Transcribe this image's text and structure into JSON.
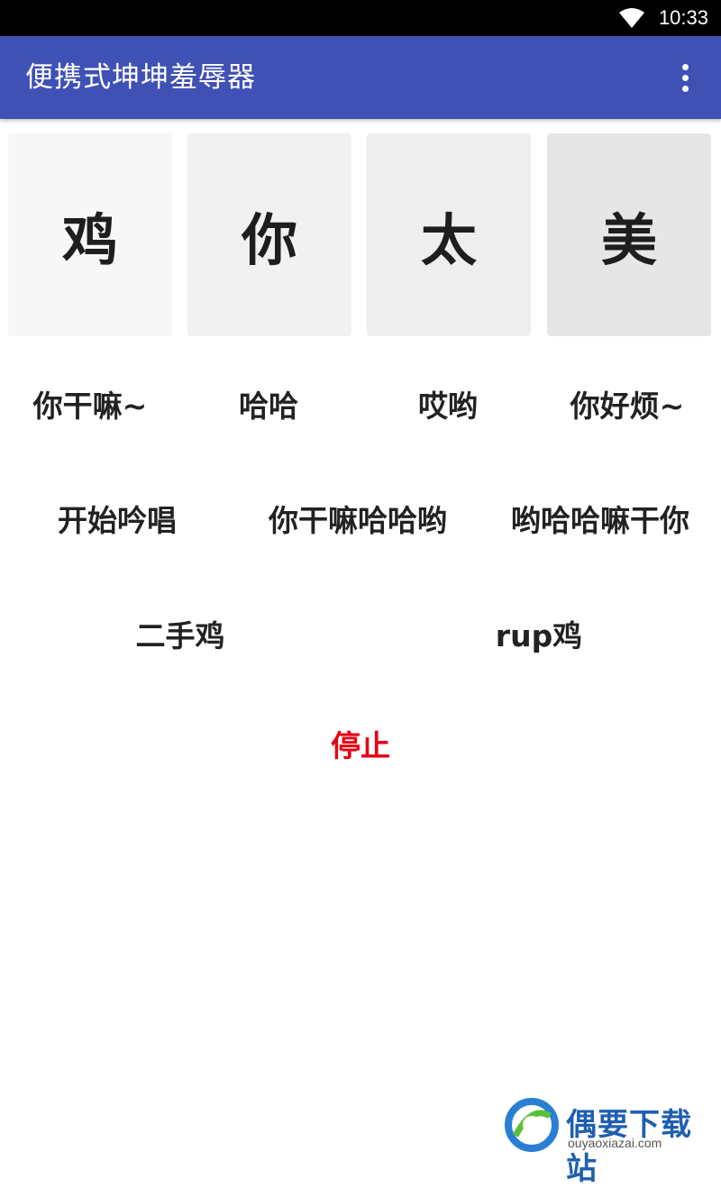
{
  "status_bar": {
    "time": "10:33",
    "icons": [
      "wifi-icon"
    ]
  },
  "app_bar": {
    "title": "便携式坤坤羞辱器",
    "menu_icon": "more-vert-icon"
  },
  "tiles": [
    {
      "label": "鸡"
    },
    {
      "label": "你"
    },
    {
      "label": "太"
    },
    {
      "label": "美"
    }
  ],
  "row1": [
    {
      "label": "你干嘛~"
    },
    {
      "label": "哈哈"
    },
    {
      "label": "哎哟"
    },
    {
      "label": "你好烦~"
    }
  ],
  "row2": [
    {
      "label": "开始吟唱"
    },
    {
      "label": "你干嘛哈哈哟"
    },
    {
      "label": "哟哈哈嘛干你"
    }
  ],
  "row3": [
    {
      "label": "二手鸡"
    },
    {
      "label": "rup鸡"
    }
  ],
  "stop": {
    "label": "停止",
    "color": "#e60012"
  },
  "watermark": {
    "name": "偶要下载站",
    "domain": "ouyaoxiazai.com"
  },
  "colors": {
    "app_bar": "#3f51b5",
    "status_bar": "#000000"
  }
}
